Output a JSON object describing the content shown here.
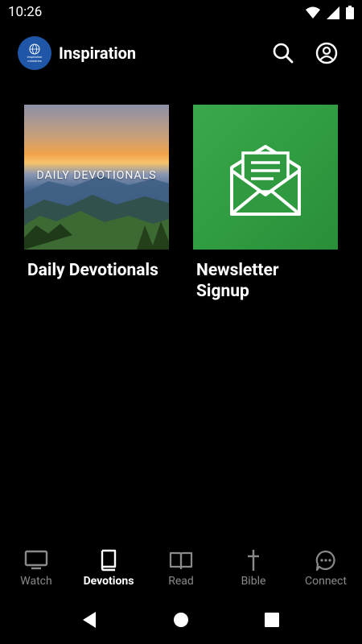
{
  "status": {
    "time": "10:26"
  },
  "app": {
    "title": "Inspiration",
    "logo_text": [
      "inspiration",
      "ministries"
    ]
  },
  "cards": [
    {
      "title": "Daily Devotionals",
      "image_caption": "DAILY DEVOTIONALS",
      "image": "mountain-sunset"
    },
    {
      "title": "Newsletter Signup",
      "image": "envelope-icon"
    }
  ],
  "bottom_nav": [
    {
      "label": "Watch",
      "icon": "tv-icon",
      "active": false
    },
    {
      "label": "Devotions",
      "icon": "book-icon",
      "active": true
    },
    {
      "label": "Read",
      "icon": "open-book-icon",
      "active": false
    },
    {
      "label": "Bible",
      "icon": "cross-icon",
      "active": false
    },
    {
      "label": "Connect",
      "icon": "chat-icon",
      "active": false
    }
  ],
  "colors": {
    "background": "#000000",
    "accent_green": "#34a449",
    "logo_blue": "#1f56a8",
    "inactive": "#8a8a8a"
  }
}
